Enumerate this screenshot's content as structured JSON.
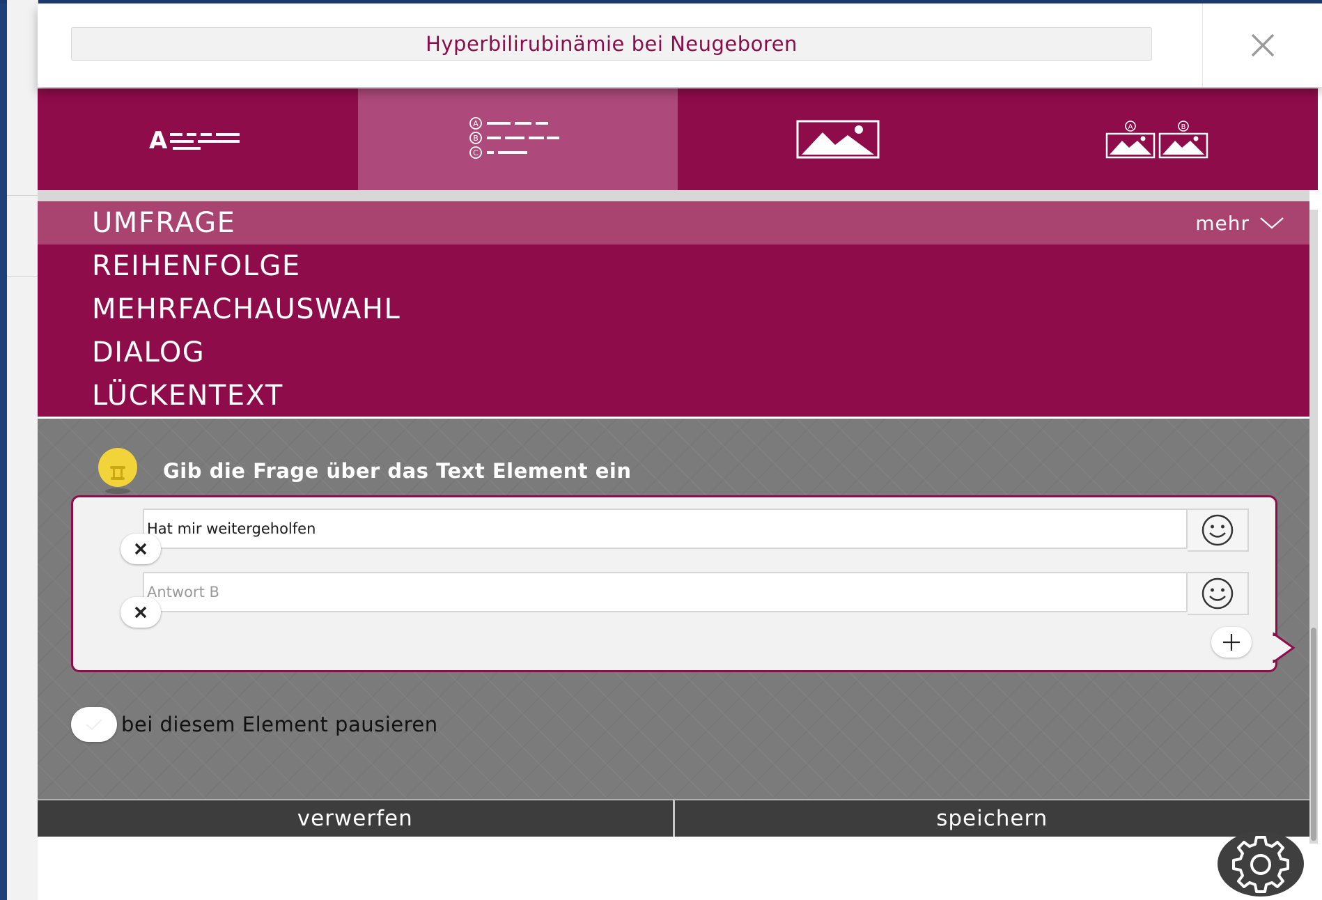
{
  "window": {
    "title": "Hyperbilirubinämie bei Neugeboren"
  },
  "tabs": [
    {
      "icon": "text-lines-icon",
      "active": false,
      "label": "A"
    },
    {
      "icon": "abc-list-icon",
      "active": true,
      "markers": [
        "A",
        "B",
        "C"
      ]
    },
    {
      "icon": "image-icon",
      "active": false
    },
    {
      "icon": "image-ab-icon",
      "active": false,
      "markers": [
        "A",
        "B"
      ]
    }
  ],
  "question_types": {
    "items": [
      {
        "label": "UMFRAGE"
      },
      {
        "label": "REIHENFOLGE"
      },
      {
        "label": "MEHRFACHAUSWAHL"
      },
      {
        "label": "DIALOG"
      },
      {
        "label": "LÜCKENTEXT"
      }
    ],
    "more_label": "mehr"
  },
  "hint": {
    "text": "Gib die Frage über das Text Element ein",
    "icon": "lightbulb-icon"
  },
  "answers": [
    {
      "value": "Hat mir weitergeholfen",
      "placeholder": ""
    },
    {
      "value": "",
      "placeholder": "Antwort B"
    }
  ],
  "pause": {
    "label": "bei diesem Element pausieren"
  },
  "actions": {
    "discard_label": "verwerfen",
    "save_label": "speichern"
  },
  "colors": {
    "brand": "#8e0c4a",
    "tab_active": "#ad4a7b",
    "item_highlight": "#a9436f",
    "content_bg": "#7b7b7b",
    "action_bg": "#3d3d3d",
    "hint_bulb": "#f2d43a"
  }
}
